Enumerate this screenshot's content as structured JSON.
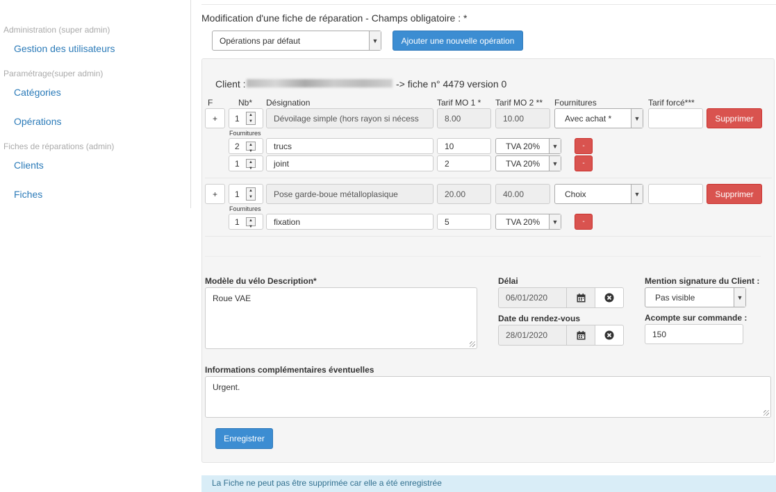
{
  "sidebar": {
    "sections": [
      {
        "title": "Administration (super admin)",
        "items": [
          "Gestion des utilisateurs"
        ]
      },
      {
        "title": "Paramétrage(super admin)",
        "items": [
          "Catégories",
          "Opérations"
        ]
      },
      {
        "title": "Fiches de réparations (admin)",
        "items": [
          "Clients",
          "Fiches"
        ]
      }
    ]
  },
  "header": {
    "title": "Modification d'une fiche de réparation - Champs obligatoire : *",
    "ops_select": "Opérations par défaut",
    "add_operation_label": "Ajouter une nouvelle opération"
  },
  "client": {
    "prefix": "Client :",
    "suffix": "-> fiche n° 4479 version 0"
  },
  "columns": {
    "f": "F",
    "nb": "Nb*",
    "designation": "Désignation",
    "mo1": "Tarif MO 1 *",
    "mo2": "Tarif MO 2 **",
    "fournitures": "Fournitures",
    "tarif_force": "Tarif forcé***"
  },
  "operations": [
    {
      "plus": "+",
      "nb": "1",
      "designation": "Dévoilage simple (hors rayon si nécess",
      "mo1": "8.00",
      "mo2": "10.00",
      "fourniture_select": "Avec achat *",
      "tarif_force": "",
      "delete_label": "Supprimer",
      "fournitures_label": "Fournitures",
      "supplies": [
        {
          "nb": "2",
          "name": "trucs",
          "price": "10",
          "tva": "TVA 20%",
          "remove": "-"
        },
        {
          "nb": "1",
          "name": "joint",
          "price": "2",
          "tva": "TVA 20%",
          "remove": "-"
        }
      ]
    },
    {
      "plus": "+",
      "nb": "1",
      "designation": "Pose garde-boue métalloplasique",
      "mo1": "20.00",
      "mo2": "40.00",
      "fourniture_select": "Choix",
      "tarif_force": "",
      "delete_label": "Supprimer",
      "fournitures_label": "Fournitures",
      "supplies": [
        {
          "nb": "1",
          "name": "fixation",
          "price": "5",
          "tva": "TVA 20%",
          "remove": "-"
        }
      ]
    }
  ],
  "form": {
    "model_label": "Modèle du vélo Description*",
    "model_value": "Roue VAE",
    "delai_label": "Délai",
    "delai_value": "06/01/2020",
    "rdv_label": "Date du rendez-vous",
    "rdv_value": "28/01/2020",
    "signature_label": "Mention signature du Client :",
    "signature_value": "Pas visible",
    "acompte_label": "Acompte sur commande :",
    "acompte_value": "150",
    "info_label": "Informations complémentaires éventuelles",
    "info_value": "Urgent.",
    "save_label": "Enregistrer"
  },
  "alert": "La Fiche ne peut pas être supprimée car elle a été enregistrée",
  "icons": {
    "calendar": "calendar-icon",
    "clear": "clear-icon"
  },
  "colors": {
    "primary": "#3c8dd2",
    "danger": "#d9534f",
    "link": "#2a7ab8",
    "alert_bg": "#d9edf7"
  }
}
